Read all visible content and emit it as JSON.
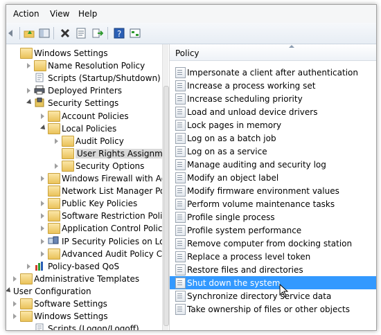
{
  "menubar": {
    "items": [
      "Action",
      "View",
      "Help"
    ]
  },
  "toolbar": {
    "icons": [
      "back-icon",
      "up-folder-icon",
      "show-hide-tree-icon",
      "delete-icon",
      "properties-icon",
      "export-list-icon",
      "help-icon",
      "console-tree-icon"
    ]
  },
  "tree": {
    "items": [
      {
        "label": "Windows Settings",
        "icon": "folder-icon",
        "expander": "none"
      },
      {
        "label": "Name Resolution Policy",
        "icon": "folder-icon",
        "expander": "closed"
      },
      {
        "label": "Scripts (Startup/Shutdown)",
        "icon": "script-icon",
        "expander": "none"
      },
      {
        "label": "Deployed Printers",
        "icon": "printer-icon",
        "expander": "closed"
      },
      {
        "label": "Security Settings",
        "icon": "shield-icon",
        "expander": "open"
      },
      {
        "label": "Account Policies",
        "icon": "folder-icon",
        "expander": "closed"
      },
      {
        "label": "Local Policies",
        "icon": "folder-icon",
        "expander": "open"
      },
      {
        "label": "Audit Policy",
        "icon": "folder-icon",
        "expander": "closed"
      },
      {
        "label": "User Rights Assignment",
        "icon": "folder-icon",
        "expander": "none"
      },
      {
        "label": "Security Options",
        "icon": "folder-icon",
        "expander": "closed"
      },
      {
        "label": "Windows Firewall with Adva",
        "icon": "folder-icon",
        "expander": "closed"
      },
      {
        "label": "Network List Manager Polic",
        "icon": "folder-icon",
        "expander": "none"
      },
      {
        "label": "Public Key Policies",
        "icon": "folder-icon",
        "expander": "closed"
      },
      {
        "label": "Software Restriction Policie",
        "icon": "folder-icon",
        "expander": "closed"
      },
      {
        "label": "Application Control Policies",
        "icon": "folder-icon",
        "expander": "closed"
      },
      {
        "label": "IP Security Policies on Loca",
        "icon": "ipsec-icon",
        "expander": "closed"
      },
      {
        "label": "Advanced Audit Policy Con",
        "icon": "folder-icon",
        "expander": "closed"
      },
      {
        "label": "Policy-based QoS",
        "icon": "chart-icon",
        "expander": "closed"
      },
      {
        "label": "Administrative Templates",
        "icon": "folder-icon",
        "expander": "closed"
      },
      {
        "label": "User Configuration",
        "icon": "none",
        "expander": "open"
      },
      {
        "label": "Software Settings",
        "icon": "folder-icon",
        "expander": "closed"
      },
      {
        "label": "Windows Settings",
        "icon": "folder-icon",
        "expander": "closed"
      },
      {
        "label": "Scripts (Logon/Logoff)",
        "icon": "script-icon",
        "expander": "none"
      }
    ],
    "selected": "User Rights Assignment"
  },
  "list": {
    "column_header": "Policy",
    "rows": [
      "Impersonate a client after authentication",
      "Increase a process working set",
      "Increase scheduling priority",
      "Load and unload device drivers",
      "Lock pages in memory",
      "Log on as a batch job",
      "Log on as a service",
      "Manage auditing and security log",
      "Modify an object label",
      "Modify firmware environment values",
      "Perform volume maintenance tasks",
      "Profile single process",
      "Profile system performance",
      "Remove computer from docking station",
      "Replace a process level token",
      "Restore files and directories",
      "Shut down the system",
      "Synchronize directory service data",
      "Take ownership of files or other objects"
    ],
    "selected": "Shut down the system"
  },
  "colors": {
    "selection": "#3399ff",
    "tree_selection": "#d9d9d9",
    "folder": "#eac25a"
  }
}
